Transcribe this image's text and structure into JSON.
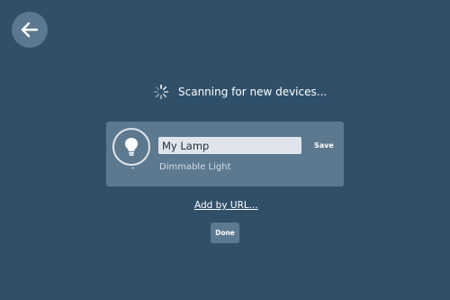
{
  "header": {
    "back_icon": "arrow-left-icon"
  },
  "scan": {
    "spinner_icon": "spinner-icon",
    "status_text": "Scanning for new devices..."
  },
  "device": {
    "icon": "lightbulb-icon",
    "name_value": "My Lamp",
    "save_label": "Save",
    "type_label": "Dimmable Light"
  },
  "actions": {
    "add_by_url_label": "Add by URL...",
    "done_label": "Done"
  },
  "colors": {
    "background": "#30506a",
    "card": "#5c7990",
    "input": "#dfe5ea",
    "text": "#ffffff"
  }
}
